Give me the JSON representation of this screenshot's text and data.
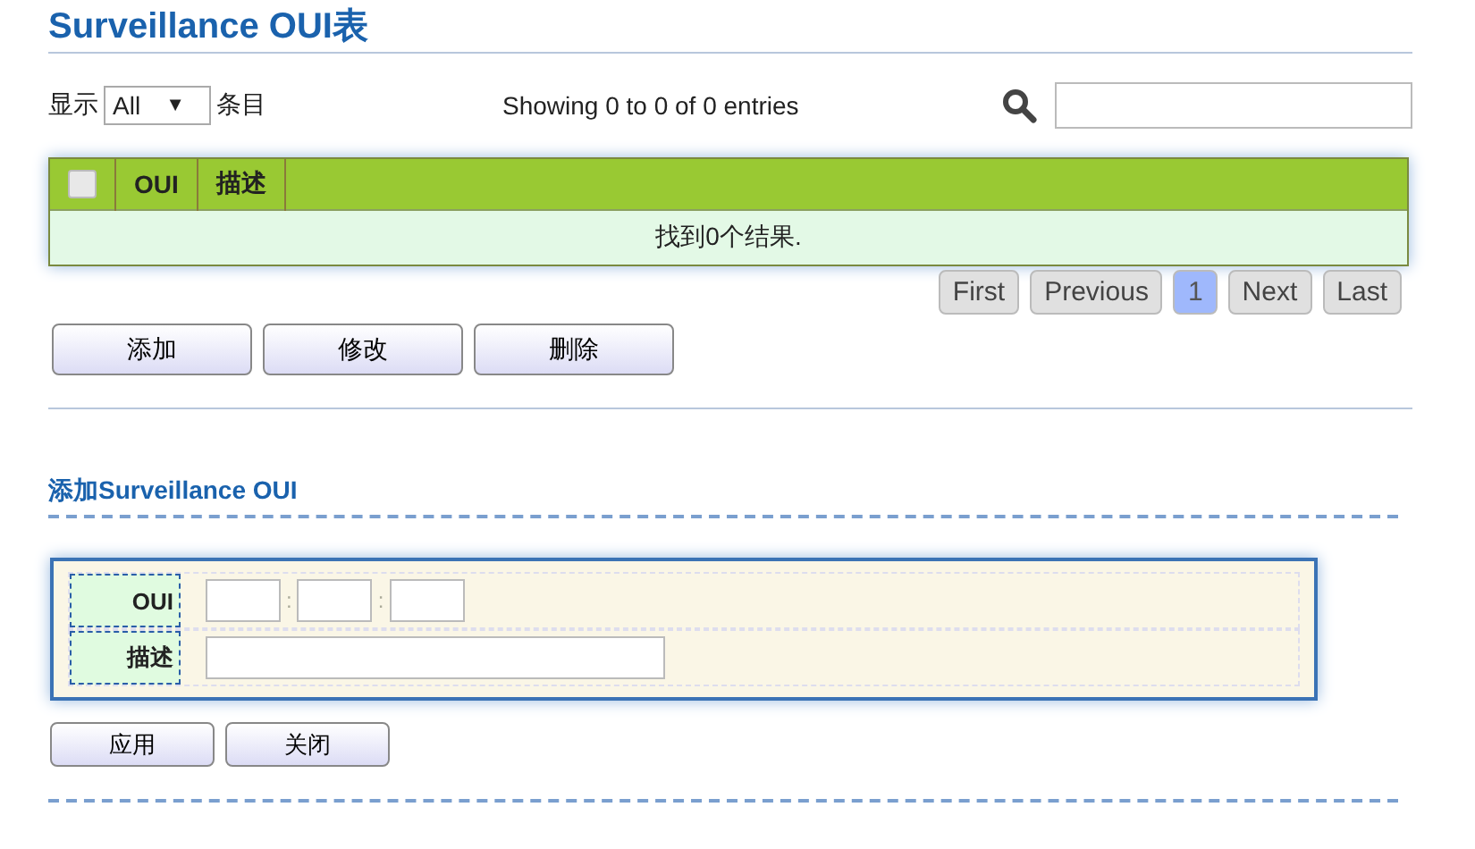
{
  "title": "Surveillance OUI表",
  "length_menu": {
    "label_before": "显示",
    "value": "All",
    "arrow": "▼",
    "label_after": "条目"
  },
  "info": "Showing 0 to 0 of 0 entries",
  "table": {
    "header_checkbox": {
      "checked": false
    },
    "columns": [
      "OUI",
      "描述"
    ],
    "empty_message": "找到0个结果."
  },
  "pagination": [
    {
      "label": "First",
      "selected": false
    },
    {
      "label": "Previous",
      "selected": false
    },
    {
      "label": "1",
      "selected": true
    },
    {
      "label": "Next",
      "selected": false
    },
    {
      "label": "Last",
      "selected": false
    }
  ],
  "actions": [
    "添加",
    "修改",
    "删除"
  ],
  "add_section": {
    "title": "添加Surveillance OUI",
    "fields": [
      {
        "kind": "oui",
        "label": "OUI",
        "separator": ":"
      },
      {
        "kind": "text",
        "label": "描述"
      }
    ],
    "buttons": [
      "应用",
      "关闭"
    ]
  }
}
